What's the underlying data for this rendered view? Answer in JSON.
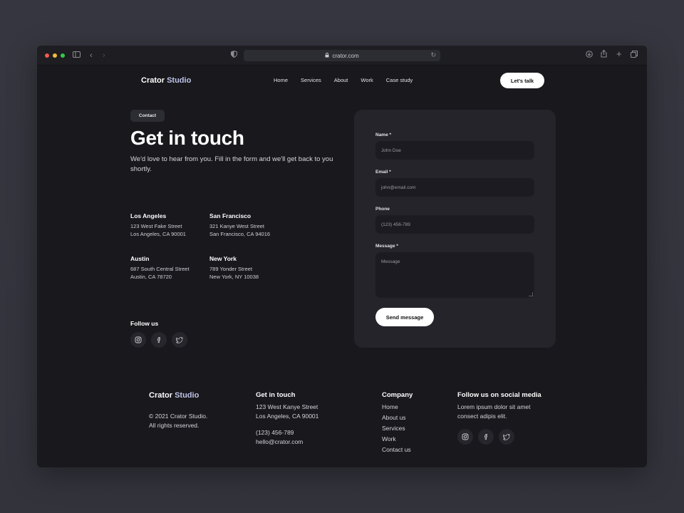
{
  "browser": {
    "url": "crator.com"
  },
  "brand": {
    "name": "Crator",
    "accent": "Studio",
    "accent_color": "#bfc4e8"
  },
  "nav": {
    "items": [
      "Home",
      "Services",
      "About",
      "Work",
      "Case study"
    ],
    "cta": "Let's talk"
  },
  "hero": {
    "badge": "Contact",
    "title": "Get in touch",
    "subtitle": "We'd love to hear from you. Fill in the form and we'll get back to you shortly."
  },
  "offices": [
    {
      "city": "Los Angeles",
      "line1": "123 West Fake Street",
      "line2": "Los Angeles, CA 90001"
    },
    {
      "city": "San Francisco",
      "line1": "321 Kanye West Street",
      "line2": "San Francisco, CA 94016"
    },
    {
      "city": "Austin",
      "line1": "687 South Central Street",
      "line2": "Austin, CA 78720"
    },
    {
      "city": "New York",
      "line1": "789 Yonder Street",
      "line2": "New York, NY 10038"
    }
  ],
  "follow": {
    "label": "Follow us",
    "icons": [
      "instagram-icon",
      "facebook-icon",
      "twitter-icon"
    ]
  },
  "form": {
    "name_label": "Name *",
    "name_placeholder": "John Doe",
    "email_label": "Email *",
    "email_placeholder": "john@email.com",
    "phone_label": "Phone",
    "phone_placeholder": "(123) 456-789",
    "message_label": "Message *",
    "message_placeholder": "Message",
    "submit": "Send message"
  },
  "footer": {
    "copyright_line1": "© 2021 Crator Studio.",
    "copyright_line2": "All rights reserved.",
    "contact_title": "Get in touch",
    "contact_addr1": "123 West Kanye Street",
    "contact_addr2": "Los Angeles, CA 90001",
    "contact_phone": "(123) 456-789",
    "contact_email": "hello@crator.com",
    "company_title": "Company",
    "company_links": [
      "Home",
      "About us",
      "Services",
      "Work",
      "Contact us"
    ],
    "social_title": "Follow us on social media",
    "social_text1": "Lorem ipsum dolor sit amet",
    "social_text2": "consect adipis elit."
  },
  "colors": {
    "page_bg": "#18181d",
    "card_bg": "#25242b",
    "input_bg": "#1c1b21"
  }
}
